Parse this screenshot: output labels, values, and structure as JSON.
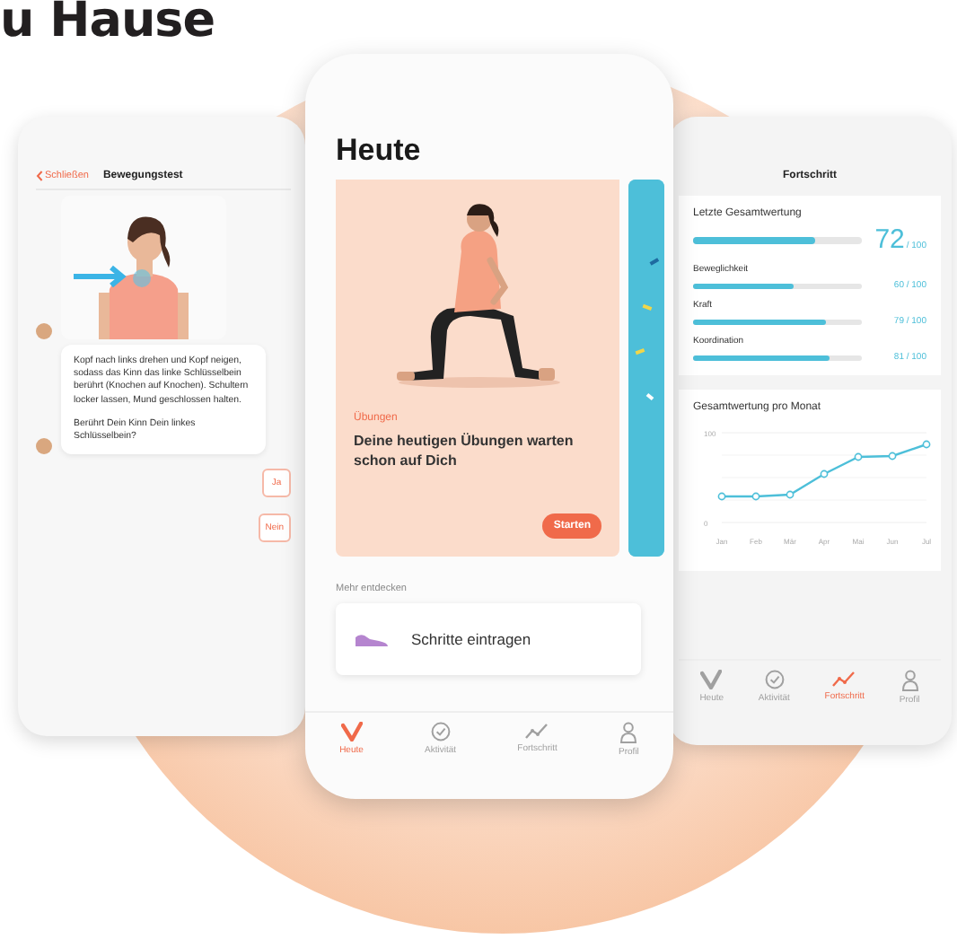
{
  "heading": "u Hause",
  "left_phone": {
    "back_link": "Schließen",
    "title": "Bewegungstest",
    "messages": [
      {
        "kind": "picture"
      },
      {
        "kind": "text",
        "paragraphs": [
          "Kopf nach links drehen und Kopf neigen, sodass das Kinn das linke Schlüsselbein berührt (Knochen auf Knochen). Schultern locker lassen, Mund geschlossen halten.",
          "Berührt Dein Kinn Dein linkes Schlüsselbein?"
        ]
      }
    ],
    "answers": [
      "Ja",
      "Nein"
    ]
  },
  "center_phone": {
    "title": "Heute",
    "cards": [
      {
        "kind": "exercise",
        "category": "Übungen",
        "text": "Deine heutigen Übungen warten schon auf Dich",
        "button": "Starten"
      },
      {
        "kind": "peek"
      }
    ],
    "section": "Mehr entdecken",
    "action": "Schritte eintragen",
    "tabs": [
      {
        "label": "Heute",
        "selected": true
      },
      {
        "label": "Aktivität",
        "selected": false
      },
      {
        "label": "Fortschritt",
        "selected": false
      },
      {
        "label": "Profil",
        "selected": false
      }
    ]
  },
  "right_phone": {
    "title": "Fortschritt",
    "overall": {
      "label": "Letzte Gesamtwertung",
      "score": "72",
      "max": "/ 100",
      "level": 0.72
    },
    "scores": [
      {
        "label": "Beweglichkeit",
        "reading": "60 / 100",
        "level": 0.6
      },
      {
        "label": "Kraft",
        "reading": "79 / 100",
        "level": 0.79
      },
      {
        "label": "Koordination",
        "reading": "81 / 100",
        "level": 0.81
      }
    ],
    "chart_title": "Gesamtwertung pro Monat",
    "chart_data": {
      "type": "line",
      "categories": [
        "Jan",
        "Feb",
        "Mär",
        "Apr",
        "Mai",
        "Jun",
        "Jul"
      ],
      "series": [
        {
          "color": "#4dbfd9",
          "marker": true,
          "values": [
            29,
            29,
            31,
            54,
            73,
            74,
            87
          ]
        }
      ],
      "ylim": [
        0,
        100
      ],
      "yticks": [
        0,
        100
      ]
    },
    "tabs": [
      {
        "label": "Heute",
        "selected": false
      },
      {
        "label": "Aktivität",
        "selected": false
      },
      {
        "label": "Fortschritt",
        "selected": true
      },
      {
        "label": "Profil",
        "selected": false
      }
    ]
  }
}
